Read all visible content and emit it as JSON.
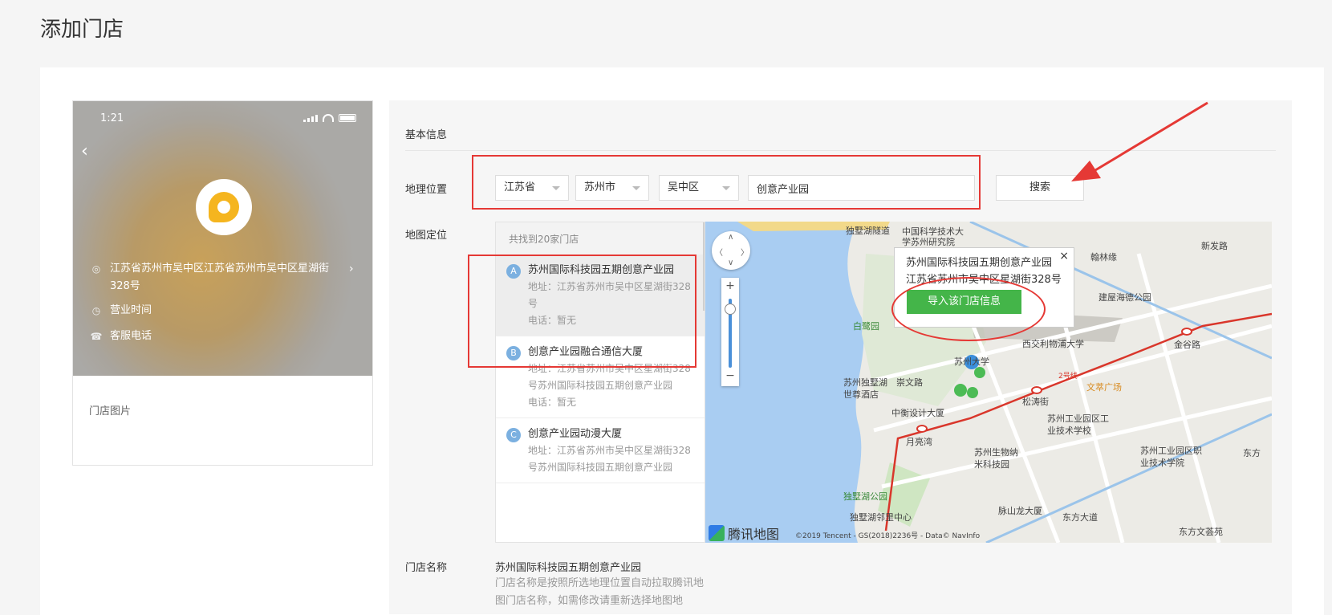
{
  "page_title": "添加门店",
  "phone": {
    "status_time": "1:21",
    "address": "江苏省苏州市吴中区江苏省苏州市吴中区星湖街328号",
    "hours_label": "营业时间",
    "phone_label": "客服电话",
    "photo_label": "门店图片"
  },
  "form": {
    "section_title": "基本信息",
    "location_label": "地理位置",
    "province": "江苏省",
    "city": "苏州市",
    "district": "吴中区",
    "keyword": "创意产业园",
    "search_label": "搜索",
    "map_label": "地图定位",
    "store_name_label": "门店名称",
    "store_name_value": "苏州国际科技园五期创意产业园",
    "store_name_hint": "门店名称是按照所选地理位置自动拉取腾讯地图门店名称，如需修改请重新选择地图地"
  },
  "results": {
    "header": "共找到20家门店",
    "items": [
      {
        "badge": "A",
        "name": "苏州国际科技园五期创意产业园",
        "address": "地址：江苏省苏州市吴中区星湖街328号",
        "tel": "电话：暂无"
      },
      {
        "badge": "B",
        "name": "创意产业园融合通信大厦",
        "address": "地址：江苏省苏州市吴中区星湖街328号苏州国际科技园五期创意产业园",
        "tel": "电话：暂无"
      },
      {
        "badge": "C",
        "name": "创意产业园动漫大厦",
        "address": "地址：江苏省苏州市吴中区星湖街328号苏州国际科技园五期创意产业园",
        "tel": ""
      }
    ]
  },
  "map": {
    "popup_title": "苏州国际科技园五期创意产业园",
    "popup_address": "江苏省苏州市吴中区星湖街328号",
    "popup_button": "导入该门店信息",
    "popup_close": "×",
    "brand": "腾讯地图",
    "copyright": "©2019 Tencent - GS(2018)2236号 - Data© NavInfo",
    "labels": [
      "独墅湖隧道",
      "中国科学技术大学苏州研究院",
      "翰林缘",
      "新发路",
      "建屋海德公园",
      "金谷路",
      "白鹭园",
      "苏州大学",
      "西交利物浦大学",
      "苏州独墅湖世尊酒店",
      "崇文路",
      "2号线",
      "文萃广场",
      "松涛街",
      "中衡设计大厦",
      "苏州工业园区工业技术学校",
      "月亮湾",
      "苏州生物纳米科技园",
      "苏州工业园区职业技术学院",
      "独墅湖公园",
      "独墅湖邻里中心",
      "脉山龙大厦",
      "东方大道",
      "东方文荟苑",
      "东方"
    ]
  },
  "colors": {
    "accent_green": "#44b549",
    "annotation_red": "#e53935",
    "water": "#a9cdf2",
    "rail": "#d9362b"
  }
}
